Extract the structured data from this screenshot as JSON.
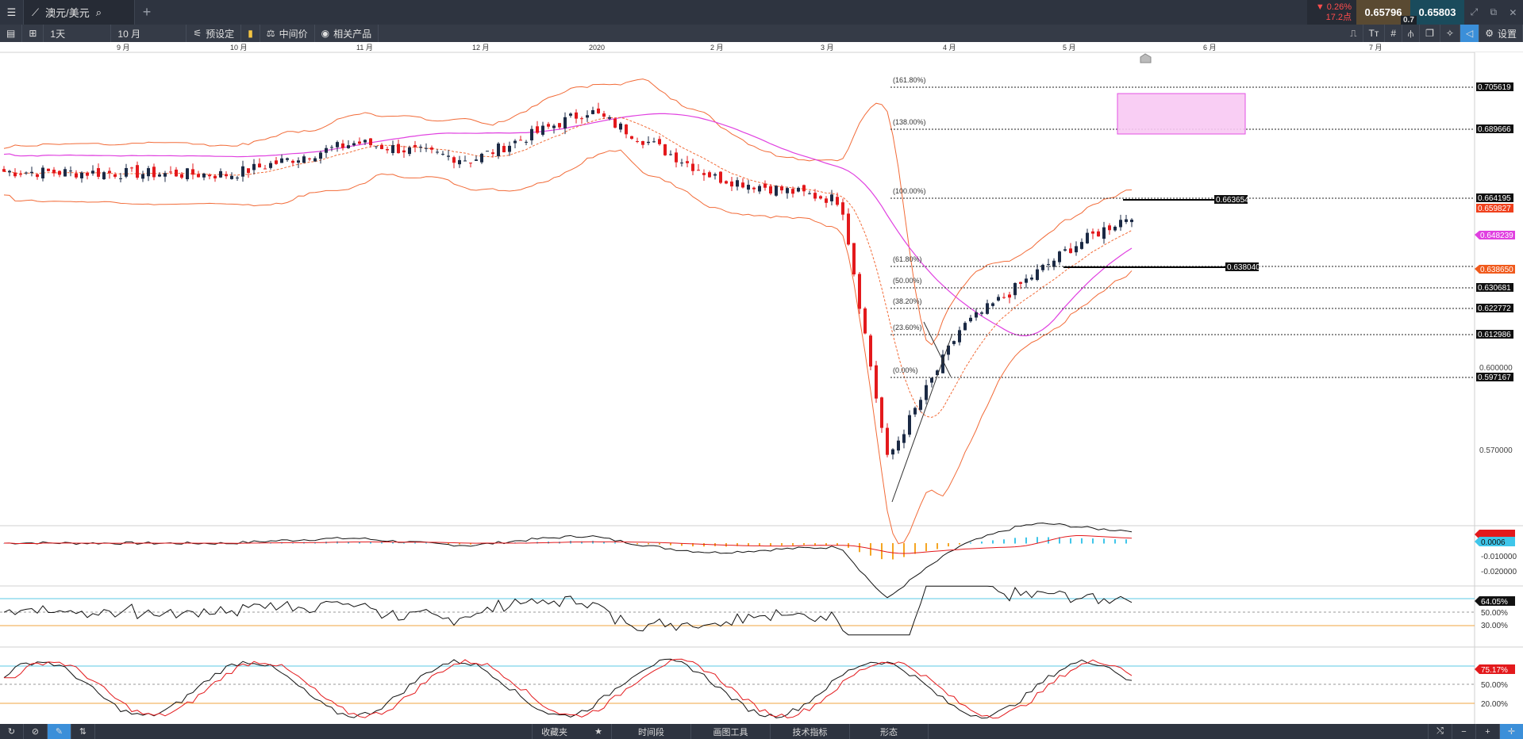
{
  "window": {
    "tab_label": "澳元/美元",
    "change_pct": "▼ 0.26%",
    "change_pts": "17.2点",
    "bid": "0.65796",
    "ask": "0.65803",
    "spread": "0.7"
  },
  "toolbar": {
    "timeframe": "1天",
    "range": "10 月",
    "preset_label": "预设定",
    "midprice_label": "中间价",
    "related_label": "相关产品",
    "settings_label": "设置"
  },
  "xaxis": {
    "labels": [
      "9 月",
      "10 月",
      "11 月",
      "12 月",
      "2020",
      "2 月",
      "3 月",
      "4 月",
      "5 月",
      "6 月",
      "7 月"
    ]
  },
  "fib": {
    "levels": [
      "(161.80%)",
      "(138.00%)",
      "(100.00%)",
      "(61.80%)",
      "(50.00%)",
      "(38.20%)",
      "(23.60%)",
      "(0.00%)"
    ],
    "level_values": [
      0.705619,
      0.689666,
      0.664195,
      0.63804,
      0.630681,
      0.622772,
      0.612986,
      0.597167
    ]
  },
  "price_axis": {
    "labels": [
      "0.705619",
      "0.689666",
      "0.664195",
      "0.659827",
      "0.648239",
      "0.638650",
      "0.630681",
      "0.622772",
      "0.612986",
      "0.600000",
      "0.597167",
      "0.570000"
    ],
    "hline_tags": [
      "0.663654",
      "0.638040"
    ]
  },
  "macd": {
    "labels": [
      "0.0006",
      "-0.010000",
      "-0.020000"
    ]
  },
  "rsi": {
    "value_tag": "64.05%",
    "labels": [
      "50.00%",
      "30.00%"
    ]
  },
  "stoch": {
    "value_tag": "75.17%",
    "labels": [
      "50.00%",
      "20.00%"
    ]
  },
  "bottom": {
    "tabs": [
      "收藏夹",
      "时间段",
      "画图工具",
      "技术指标",
      "形态"
    ]
  },
  "colors": {
    "up": "#1b2a45",
    "down": "#e3191c",
    "bollinger": "#f26b38",
    "ma": "#e040e0",
    "psar": "#f26b38",
    "rsi_band_high": "#5bc8e6",
    "rsi_band_low": "#f0a640"
  },
  "chart_data": {
    "type": "candlestick",
    "instrument": "澳元/美元",
    "timeframe": "1天",
    "ylim": [
      0.555,
      0.715
    ],
    "indicators": [
      "Bollinger Bands",
      "Moving Average",
      "Parabolic SAR",
      "Fibonacci",
      "MACD",
      "RSI",
      "Stochastic"
    ],
    "anchors": [
      {
        "month": "9 月",
        "price": 0.674
      },
      {
        "month": "10 月",
        "price": 0.673
      },
      {
        "month": "11 月",
        "price": 0.684
      },
      {
        "month": "12 月",
        "price": 0.678
      },
      {
        "month": "2020",
        "price": 0.695
      },
      {
        "month": "2 月",
        "price": 0.672
      },
      {
        "month": "3 月",
        "price": 0.664
      },
      {
        "month": "3 月",
        "price": 0.575
      },
      {
        "month": "4 月",
        "price": 0.62
      },
      {
        "month": "5 月",
        "price": 0.648
      },
      {
        "month": "5 月",
        "price": 0.66
      }
    ]
  }
}
